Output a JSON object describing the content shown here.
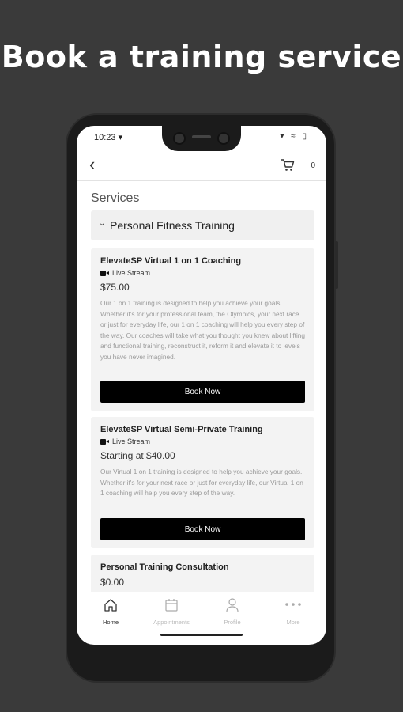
{
  "headline": "Book a training service",
  "status_bar": {
    "time": "10:23 ▾",
    "icons": "▾ ≈ ▯"
  },
  "app_bar": {
    "back_glyph": "‹",
    "cart_count": "0"
  },
  "services": {
    "title": "Services",
    "category": {
      "label": "Personal Fitness Training",
      "chevron": "⌄"
    },
    "items": [
      {
        "name": "ElevateSP Virtual 1 on 1 Coaching",
        "tag": "Live Stream",
        "price": "$75.00",
        "description": "Our 1 on 1 training is designed to help you achieve your goals. Whether it's for your professional team, the Olympics, your next race or just for everyday life, our 1 on 1 coaching will help you every step of the way. Our coaches will take what you thought you knew about lifting and functional training, reconstruct it, reform it and elevate it to levels you have never imagined.",
        "button": "Book Now"
      },
      {
        "name": "ElevateSP Virtual Semi-Private Training",
        "tag": "Live Stream",
        "price": "Starting at $40.00",
        "description": "Our Virtual 1 on 1 training is designed to help you achieve your goals. Whether it's for your next race or just for everyday life, our Virtual 1 on 1 coaching will help you every step of the way.",
        "button": "Book Now"
      },
      {
        "name": "Personal Training Consultation",
        "price": "$0.00"
      }
    ]
  },
  "tabs": [
    {
      "label": "Home",
      "icon": "home-icon",
      "active": true
    },
    {
      "label": "Appointments",
      "icon": "calendar-icon",
      "active": false
    },
    {
      "label": "Profile",
      "icon": "person-icon",
      "active": false
    },
    {
      "label": "More",
      "icon": "more-icon",
      "active": false
    }
  ]
}
